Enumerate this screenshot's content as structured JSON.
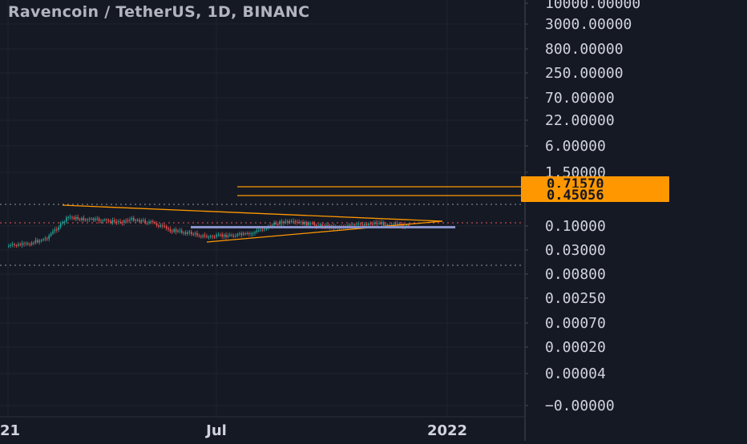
{
  "chart_data": {
    "type": "candlestick",
    "title": "Ravencoin / TetherUS, 1D, BINANC",
    "y_scale": "log",
    "y_ticks": [
      "10000.00000",
      "3000.00000",
      "800.00000",
      "250.00000",
      "70.00000",
      "22.00000",
      "6.00000",
      "1.50000",
      "0.10000",
      "0.03000",
      "0.00800",
      "0.00250",
      "0.00070",
      "0.00020",
      "0.00004",
      "−0.00000"
    ],
    "x_ticks": [
      "21",
      "Jul",
      "2022"
    ],
    "price_tags": [
      {
        "value": "0.71570",
        "color": "#ff9800"
      },
      {
        "value": "0.45056",
        "color": "#ff9800"
      }
    ],
    "series": [
      {
        "values": [
          {
            "date": "2021-01-01",
            "close": 0.027
          },
          {
            "date": "2021-01-15",
            "close": 0.03
          },
          {
            "date": "2021-02-01",
            "close": 0.045
          },
          {
            "date": "2021-02-10",
            "close": 0.09
          },
          {
            "date": "2021-02-20",
            "close": 0.2
          },
          {
            "date": "2021-03-01",
            "close": 0.17
          },
          {
            "date": "2021-03-15",
            "close": 0.16
          },
          {
            "date": "2021-04-01",
            "close": 0.14
          },
          {
            "date": "2021-04-15",
            "close": 0.17
          },
          {
            "date": "2021-05-01",
            "close": 0.13
          },
          {
            "date": "2021-05-15",
            "close": 0.08
          },
          {
            "date": "2021-06-01",
            "close": 0.065
          },
          {
            "date": "2021-06-15",
            "close": 0.05
          },
          {
            "date": "2021-07-01",
            "close": 0.055
          },
          {
            "date": "2021-07-20",
            "close": 0.06
          },
          {
            "date": "2021-08-01",
            "close": 0.09
          },
          {
            "date": "2021-08-15",
            "close": 0.14
          },
          {
            "date": "2021-09-01",
            "close": 0.13
          },
          {
            "date": "2021-09-15",
            "close": 0.11
          },
          {
            "date": "2021-10-01",
            "close": 0.1
          },
          {
            "date": "2021-10-15",
            "close": 0.11
          },
          {
            "date": "2021-11-01",
            "close": 0.13
          },
          {
            "date": "2021-11-15",
            "close": 0.12
          },
          {
            "date": "2021-12-01",
            "close": 0.1
          }
        ]
      }
    ],
    "grid": true,
    "colors": {
      "background": "#151924",
      "up": "#26a69a",
      "down": "#ef5350",
      "trendline": "#ff9800",
      "support": "#8b93c9",
      "tag": "#ff9800",
      "text": "#d1d4dc"
    }
  }
}
